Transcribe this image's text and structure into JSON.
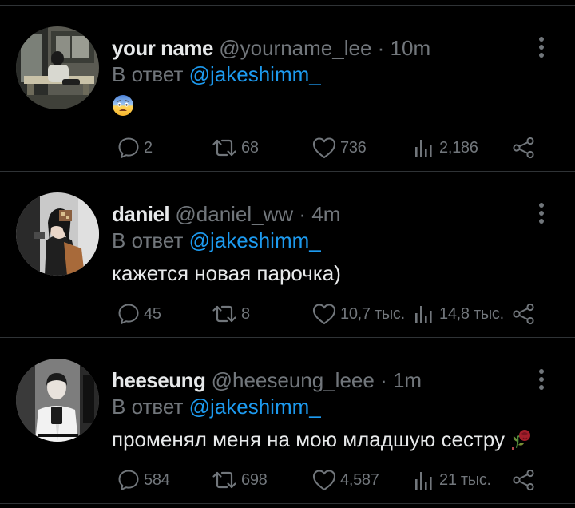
{
  "tweets": [
    {
      "name": "your name",
      "handle": "@yourname_lee",
      "time": "· 10m",
      "reply_prefix": "В ответ",
      "reply_to": "@jakeshimm_",
      "text": "",
      "emoji": "fearful-face",
      "replies": "2",
      "retweets": "68",
      "likes": "736",
      "views": "2,186"
    },
    {
      "name": "daniel",
      "handle": "@daniel_ww",
      "time": "· 4m",
      "reply_prefix": "В ответ",
      "reply_to": "@jakeshimm_",
      "text": "кажется новая парочка)",
      "replies": "45",
      "retweets": "8",
      "likes": "10,7 тыс.",
      "views": "14,8 тыс."
    },
    {
      "name": "heeseung",
      "handle": "@heeseung_leee",
      "time": "· 1m",
      "reply_prefix": "В ответ",
      "reply_to": "@jakeshimm_",
      "text": "променял меня на мою младшую сестру",
      "emoji": "wilted-rose",
      "replies": "584",
      "retweets": "698",
      "likes": "4,587",
      "views": "21 тыс."
    }
  ],
  "colors": {
    "background": "#000000",
    "text": "#e7e9ea",
    "muted": "#71767b",
    "accent": "#1d9bf0",
    "divider": "#2f3336"
  },
  "icons": [
    "reply-icon",
    "retweet-icon",
    "like-icon",
    "views-icon",
    "share-icon",
    "more-icon"
  ]
}
